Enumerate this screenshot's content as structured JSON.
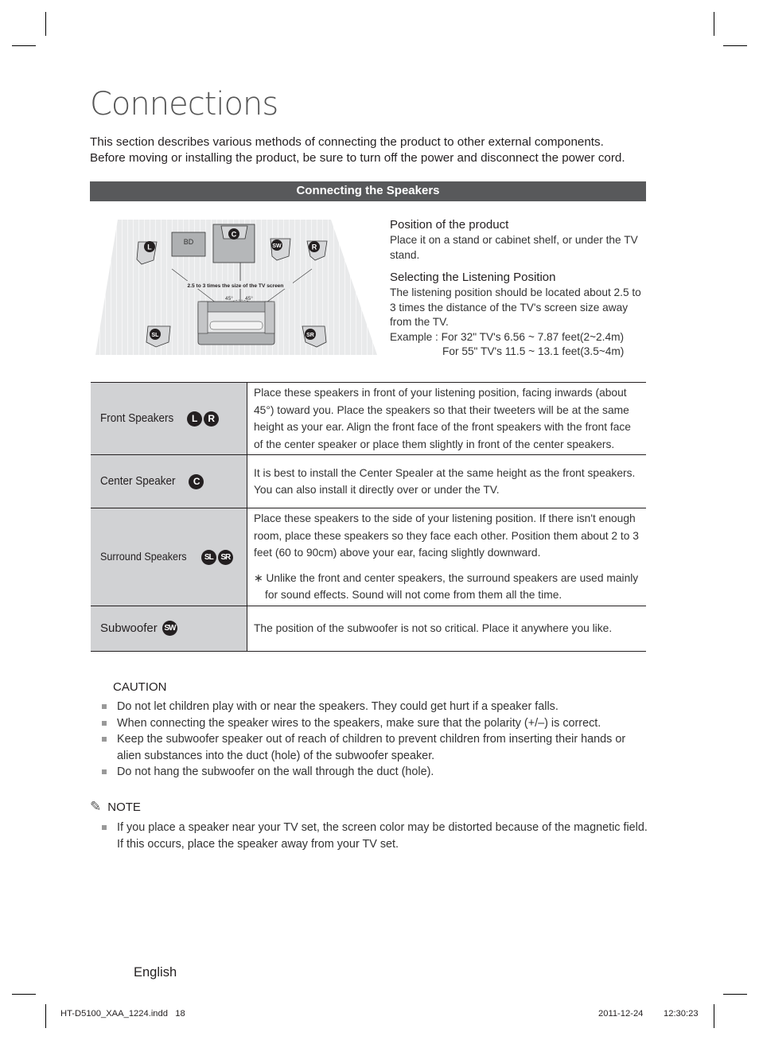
{
  "page": {
    "title": "Connections",
    "intro": [
      "This section describes various methods of connecting the product to other external components.",
      "Before moving or installing the product, be sure to turn off the power and disconnect the power cord."
    ],
    "section_header": "Connecting the Speakers"
  },
  "diagram": {
    "labels": {
      "bd": "BD",
      "center": "C",
      "left": "L",
      "right": "R",
      "subwoofer": "SW",
      "surround_left": "SL",
      "surround_right": "SR",
      "distance": "2.5 to 3 times the size of the TV screen",
      "angle_left": "45°",
      "angle_right": "45°"
    }
  },
  "position": {
    "heading": "Position of the product",
    "text": "Place it on a stand or cabinet shelf, or under the TV stand."
  },
  "listening": {
    "heading": "Selecting the Listening Position",
    "text": "The listening position should be located about 2.5 to 3 times the distance of the TV's screen size away from the TV.",
    "example1": "Example : For 32\" TV's 6.56 ~ 7.87 feet(2~2.4m)",
    "example2": "For 55\" TV's 11.5 ~ 13.1 feet(3.5~4m)"
  },
  "speakers_table": [
    {
      "label": "Front Speakers",
      "badges": [
        "L",
        "R"
      ],
      "description": "Place these speakers in front of your listening position, facing inwards (about 45°) toward you. Place the speakers so that their tweeters will be at the same height as your ear. Align the front face of the front speakers with the front face of the center speaker or place them slightly in front of the center speakers."
    },
    {
      "label": "Center Speaker",
      "badges": [
        "C"
      ],
      "description": "It is best to install the Center Spealer at the same height as the front speakers. You can also install it directly over or under the TV."
    },
    {
      "label": "Surround Speakers",
      "badges": [
        "SL",
        "SR"
      ],
      "description": "Place these speakers to the side of your listening position. If there isn't enough room, place these speakers so they face each other. Position them about 2 to 3 feet (60 to 90cm) above your ear, facing slightly downward.",
      "note": "∗ Unlike the front and center speakers, the surround speakers are used mainly for sound effects. Sound will not come from them all the time."
    },
    {
      "label": "Subwoofer",
      "badges": [
        "SW"
      ],
      "description": "The position of the subwoofer is not so critical. Place it anywhere you like."
    }
  ],
  "caution": {
    "heading": "CAUTION",
    "items": [
      "Do not let children play with or near the speakers. They could get hurt if a speaker falls.",
      "When connecting the speaker wires to the speakers, make sure that the polarity (+/–) is correct.",
      "Keep the subwoofer speaker out of reach of children to prevent children from inserting their hands or alien substances into the duct (hole) of the subwoofer speaker.",
      "Do not hang the subwoofer on the wall through the duct (hole)."
    ]
  },
  "note": {
    "icon": "pencil-icon",
    "heading": "NOTE",
    "items": [
      "If you place a speaker near your TV set, the screen color may be distorted because of the magnetic field. If this occurs, place the speaker away from your TV set."
    ]
  },
  "footer": {
    "language": "English",
    "slug_file": "HT-D5100_XAA_1224.indd   18",
    "slug_date": "2011-12-24",
    "slug_time": "12:30:23"
  }
}
